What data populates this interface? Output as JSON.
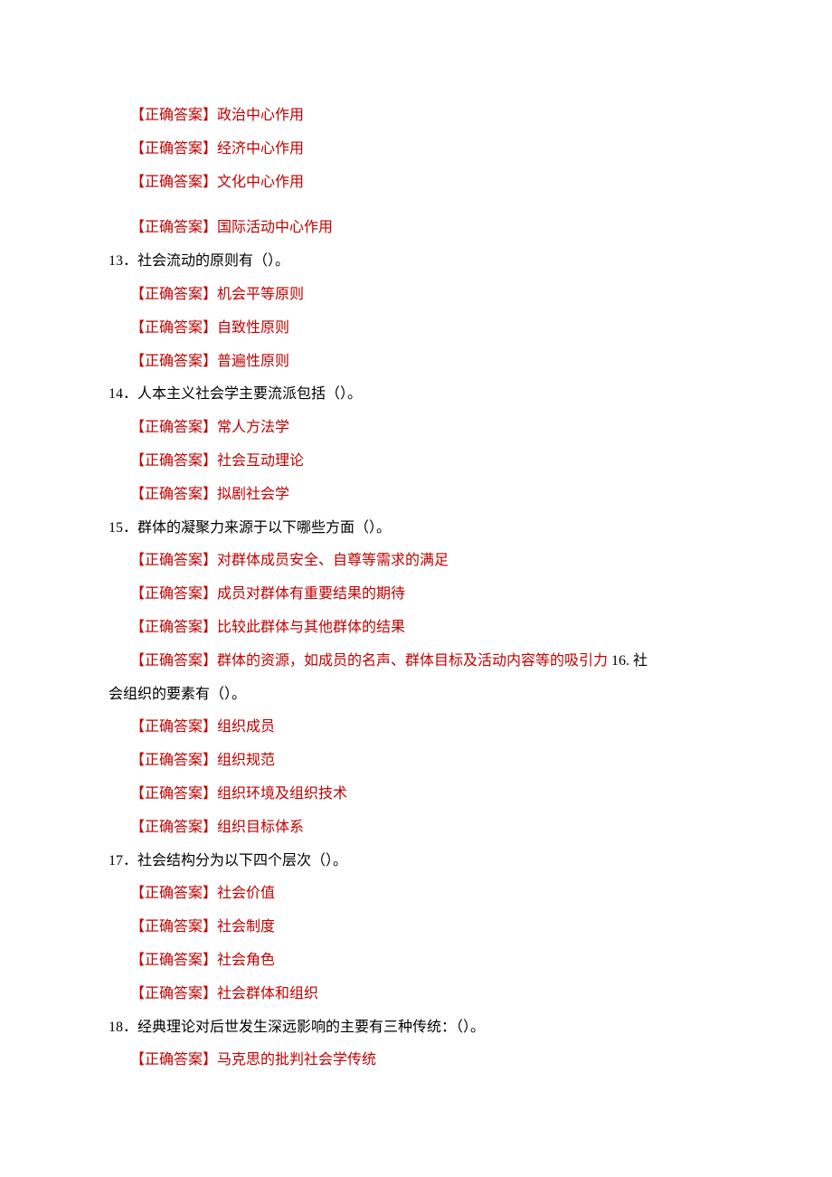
{
  "answerPrefix": "【正确答案】",
  "q12": {
    "answers": [
      "政治中心作用",
      "经济中心作用",
      "文化中心作用",
      "国际活动中心作用"
    ]
  },
  "q13": {
    "number": "13",
    "text": "．社会流动的原则有（）。",
    "answers": [
      "机会平等原则",
      "自致性原则",
      "普遍性原则"
    ]
  },
  "q14": {
    "number": "14",
    "text": "．人本主义社会学主要流派包括（）。",
    "answers": [
      "常人方法学",
      "社会互动理论",
      "拟剧社会学"
    ]
  },
  "q15": {
    "number": "15",
    "text": "．群体的凝聚力来源于以下哪些方面（）。",
    "answers": [
      "对群体成员安全、自尊等需求的满足",
      "成员对群体有重要结果的期待",
      "比较此群体与其他群体的结果"
    ],
    "lastAnswerPart1": "群体的资源，如成员的名声、群体目标及活动内容等的吸引力 ",
    "q16numInline": "16. ",
    "q16textInlinePart1": "社",
    "q16textWrapped": "会组织的要素有（）。"
  },
  "q16": {
    "answers": [
      "组织成员",
      "组织规范",
      "组织环境及组织技术",
      "组织目标体系"
    ]
  },
  "q17": {
    "number": "17",
    "text": "．社会结构分为以下四个层次（）。",
    "answers": [
      "社会价值",
      "社会制度",
      "社会角色",
      "社会群体和组织"
    ]
  },
  "q18": {
    "number": "18",
    "text": "．经典理论对后世发生深远影响的主要有三种传统：（）。",
    "answers": [
      "马克思的批判社会学传统"
    ]
  }
}
